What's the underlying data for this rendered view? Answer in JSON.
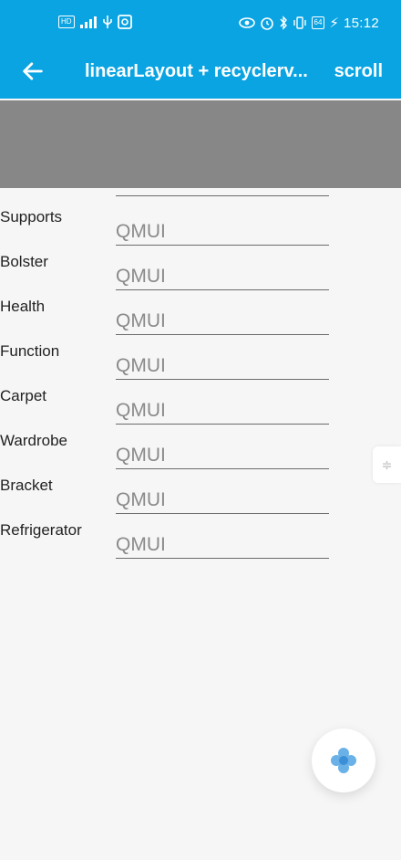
{
  "status_bar": {
    "left_icons": [
      "hd-icon",
      "signal-icon",
      "usb-icon",
      "app-notification-icon"
    ],
    "right_icons": [
      "eye-icon",
      "alarm-icon",
      "bluetooth-icon",
      "vibrate-icon"
    ],
    "battery": "64",
    "time": "15:12"
  },
  "app_bar": {
    "back_icon": "arrow-left-icon",
    "title": "linearLayout + recyclerv...",
    "action_label": "scroll"
  },
  "form": {
    "rows": [
      {
        "label": "Supports",
        "value": "QMUI"
      },
      {
        "label": "Bolster",
        "value": "QMUI"
      },
      {
        "label": "Health",
        "value": "QMUI"
      },
      {
        "label": "Function",
        "value": "QMUI"
      },
      {
        "label": "Carpet",
        "value": "QMUI"
      },
      {
        "label": "Wardrobe",
        "value": "QMUI"
      },
      {
        "label": "Bracket",
        "value": "QMUI"
      },
      {
        "label": "Refrigerator",
        "value": "QMUI"
      }
    ]
  },
  "fab": {
    "icon": "flower-icon",
    "color": "#5aa9e6"
  },
  "colors": {
    "accent": "#0aa4e2",
    "header_block": "#878787"
  }
}
